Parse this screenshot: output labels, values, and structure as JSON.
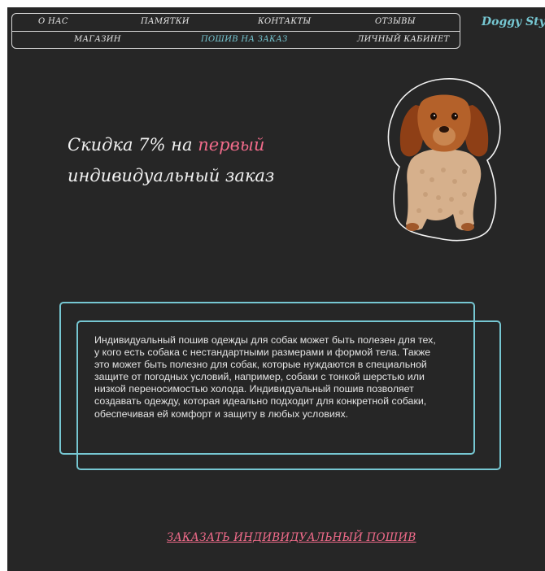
{
  "nav": {
    "row1": [
      "О НАС",
      "ПАМЯТКИ",
      "КОНТАКТЫ",
      "ОТЗЫВЫ"
    ],
    "row2": [
      "МАГАЗИН",
      "ПОШИВ НА ЗАКАЗ",
      "ЛИЧНЫЙ КАБИНЕТ"
    ],
    "active": "ПОШИВ НА ЗАКАЗ"
  },
  "brand": "Doggy Style",
  "promo": {
    "prefix": "Скидка 7% на ",
    "accent": "первый",
    "line2": "индивидуальный заказ"
  },
  "info": "Индивидуальный пошив одежды для собак может быть полезен для тех, у кого есть собака с нестандартными размерами и формой тела. Также это может быть полезно для собак, которые нуждаются в специальной защите от погодных условий, например, собаки с тонкой шерстью или низкой переносимостью холода. Индивидуальный пошив позволяет создавать одежду, которая идеально подходит для конкретной собаки, обеспечивая ей комфорт и защиту в любых условиях.",
  "cta": "ЗАКАЗАТЬ ИНДИВИДУАЛЬНЫЙ ПОШИВ",
  "colors": {
    "background": "#262626",
    "accent_teal": "#76c7d2",
    "accent_pink": "#f06b8a",
    "text": "#e4e4e4"
  },
  "image": {
    "icon": "dog-in-sweater-illustration"
  }
}
